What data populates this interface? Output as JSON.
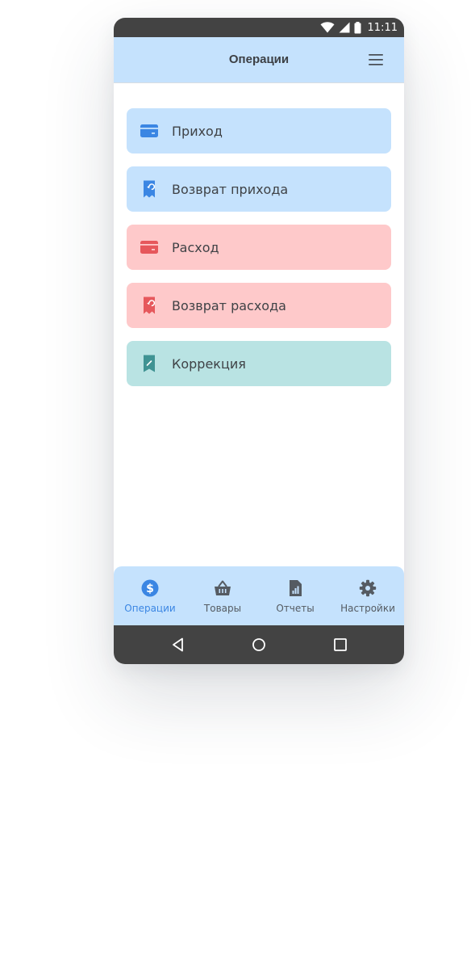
{
  "status_bar": {
    "time": "11:11",
    "icons": [
      "wifi-icon",
      "cellular-signal-icon",
      "battery-icon"
    ]
  },
  "header": {
    "title": "Операции",
    "menu_icon": "hamburger-menu-icon"
  },
  "operations": [
    {
      "label": "Приход",
      "icon": "card-icon",
      "bg": "#c5e2fd",
      "icon_color": "#3b86e3"
    },
    {
      "label": "Возврат прихода",
      "icon": "receipt-return-icon",
      "bg": "#c5e2fd",
      "icon_color": "#3b86e3"
    },
    {
      "label": "Расход",
      "icon": "card-icon",
      "bg": "#fec9ca",
      "icon_color": "#e6585c"
    },
    {
      "label": "Возврат расхода",
      "icon": "receipt-return-icon",
      "bg": "#fec9ca",
      "icon_color": "#e6585c"
    },
    {
      "label": "Коррекция",
      "icon": "receipt-edit-icon",
      "bg": "#b9e3e3",
      "icon_color": "#3f9393"
    }
  ],
  "bottom_nav": {
    "items": [
      {
        "label": "Операции",
        "icon": "dollar-circle-icon",
        "active": true
      },
      {
        "label": "Товары",
        "icon": "basket-icon",
        "active": false
      },
      {
        "label": "Отчеты",
        "icon": "report-document-icon",
        "active": false
      },
      {
        "label": "Настройки",
        "icon": "gear-icon",
        "active": false
      }
    ]
  },
  "system_nav": {
    "buttons": [
      "back-icon",
      "home-icon",
      "recents-icon"
    ]
  },
  "colors": {
    "accent": "#3b86e3",
    "header_bg": "#c5e2fd",
    "system_bar": "#434343",
    "expense": "#e6585c",
    "correction": "#3f9393"
  }
}
